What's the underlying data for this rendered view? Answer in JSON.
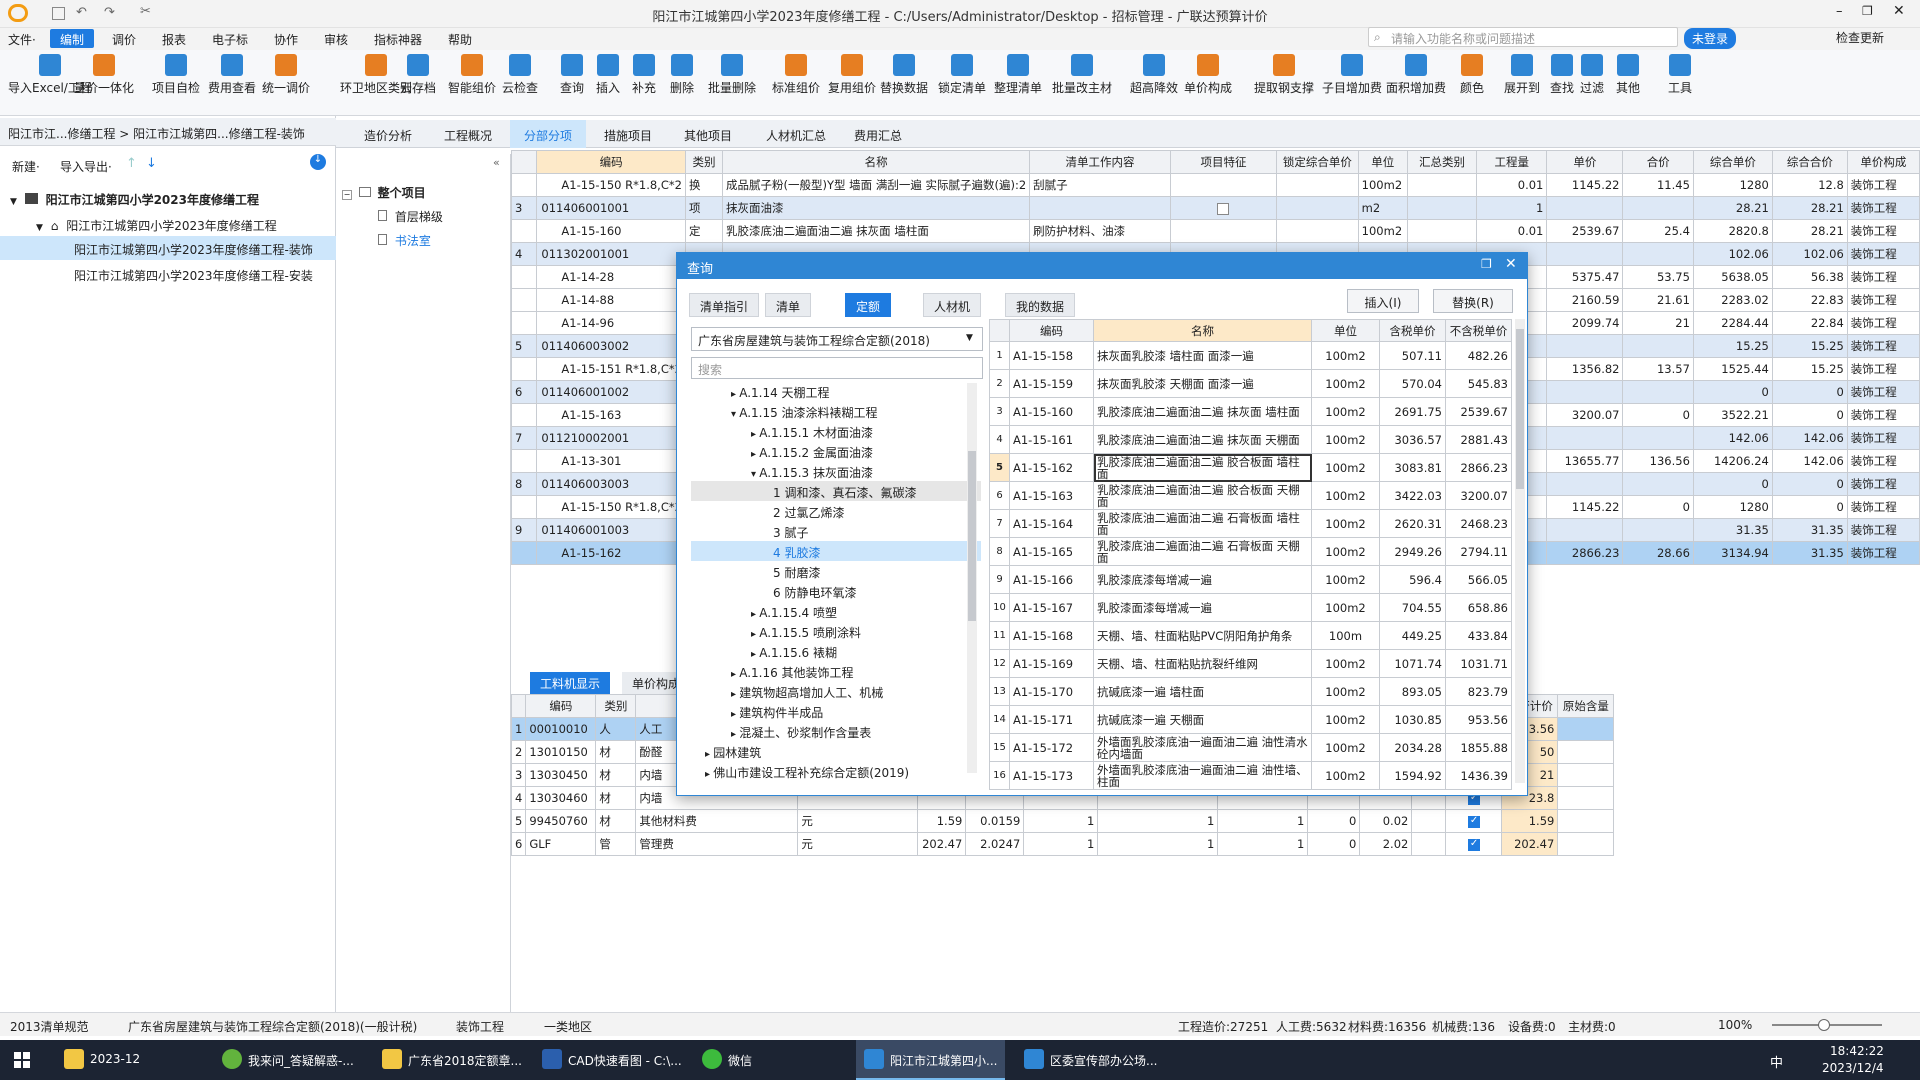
{
  "window": {
    "title": "阳江市江城第四小学2023年度修缮工程 - C:/Users/Administrator/Desktop - 招标管理 - 广联达预算计价"
  },
  "menu": [
    "文件·",
    "编制",
    "调价",
    "报表",
    "电子标",
    "协作",
    "审核",
    "指标神器",
    "帮助"
  ],
  "search": {
    "placeholder": "请输入功能名称或问题描述"
  },
  "account": {
    "login": "未登录",
    "check_update": "检查更新"
  },
  "ribbon": [
    {
      "label": "导入Excel/工程"
    },
    {
      "label": "量价一体化"
    },
    {
      "label": "项目自检"
    },
    {
      "label": "费用查看"
    },
    {
      "label": "统一调价"
    },
    {
      "label": "环卫地区类别"
    },
    {
      "label": "云存档"
    },
    {
      "label": "智能组价"
    },
    {
      "label": "云检查"
    },
    {
      "label": "查询"
    },
    {
      "label": "插入"
    },
    {
      "label": "补充"
    },
    {
      "label": "删除"
    },
    {
      "label": "批量删除"
    },
    {
      "label": "标准组价"
    },
    {
      "label": "复用组价"
    },
    {
      "label": "替换数据"
    },
    {
      "label": "锁定清单"
    },
    {
      "label": "整理清单"
    },
    {
      "label": "批量改主材"
    },
    {
      "label": "超高降效"
    },
    {
      "label": "单价构成"
    },
    {
      "label": "提取钢支撑"
    },
    {
      "label": "子目增加费"
    },
    {
      "label": "面积增加费"
    },
    {
      "label": "颜色"
    },
    {
      "label": "展开到"
    },
    {
      "label": "查找"
    },
    {
      "label": "过滤"
    },
    {
      "label": "其他"
    },
    {
      "label": "工具"
    }
  ],
  "left": {
    "breadcrumb": "阳江市江...修缮工程 > 阳江市江城第四...修缮工程-装饰",
    "new_label": "新建·",
    "import_label": "导入导出·",
    "tree": [
      "阳江市江城第四小学2023年度修缮工程",
      "阳江市江城第四小学2023年度修缮工程",
      "阳江市江城第四小学2023年度修缮工程-装饰",
      "阳江市江城第四小学2023年度修缮工程-安装"
    ]
  },
  "subtree": [
    "整个项目",
    "首层梯级",
    "书法室"
  ],
  "tabs": [
    "造价分析",
    "工程概况",
    "分部分项",
    "措施项目",
    "其他项目",
    "人材机汇总",
    "费用汇总"
  ],
  "main_table": {
    "headers": [
      "编码",
      "类别",
      "名称",
      "清单工作内容",
      "项目特征",
      "锁定综合单价",
      "单位",
      "汇总类别",
      "工程量",
      "单价",
      "合价",
      "综合单价",
      "综合合价",
      "单价构成"
    ],
    "rows": [
      {
        "no": "",
        "code": "A1-15-150 R*1.8,C*2",
        "type": "换",
        "name": "成品腻子粉(一般型)Y型 墙面 满刮一遍 实际腻子遍数(遍):2",
        "work": "刮腻子",
        "unit": "100m2",
        "qty": "0.01",
        "price": "1145.22",
        "total": "11.45",
        "uprice": "1280",
        "utotal": "12.8",
        "comp": "装饰工程"
      },
      {
        "no": "3",
        "code": "011406001001",
        "type": "项",
        "name": "抹灰面油漆",
        "work": "",
        "unit": "m2",
        "qty": "1",
        "price": "",
        "total": "",
        "uprice": "28.21",
        "utotal": "28.21",
        "comp": "装饰工程"
      },
      {
        "no": "",
        "code": "A1-15-160",
        "type": "定",
        "name": "乳胶漆底油二遍面油二遍 抹灰面 墙柱面",
        "work": "刷防护材料、油漆",
        "unit": "100m2",
        "qty": "0.01",
        "price": "2539.67",
        "total": "25.4",
        "uprice": "2820.8",
        "utotal": "28.21",
        "comp": "装饰工程"
      },
      {
        "no": "4",
        "code": "011302001001",
        "type": "",
        "name": "",
        "work": "",
        "unit": "",
        "qty": "",
        "price": "",
        "total": "",
        "uprice": "102.06",
        "utotal": "102.06",
        "comp": "装饰工程"
      },
      {
        "no": "",
        "code": "A1-14-28",
        "type": "",
        "name": "",
        "work": "",
        "unit": "",
        "qty": "",
        "price": "5375.47",
        "total": "53.75",
        "uprice": "5638.05",
        "utotal": "56.38",
        "comp": "装饰工程"
      },
      {
        "no": "",
        "code": "A1-14-88",
        "type": "",
        "name": "",
        "work": "",
        "unit": "",
        "qty": "",
        "price": "2160.59",
        "total": "21.61",
        "uprice": "2283.02",
        "utotal": "22.83",
        "comp": "装饰工程"
      },
      {
        "no": "",
        "code": "A1-14-96",
        "type": "",
        "name": "",
        "work": "",
        "unit": "",
        "qty": "",
        "price": "2099.74",
        "total": "21",
        "uprice": "2284.44",
        "utotal": "22.84",
        "comp": "装饰工程"
      },
      {
        "no": "5",
        "code": "011406003002",
        "type": "",
        "name": "",
        "work": "",
        "unit": "",
        "qty": "",
        "price": "",
        "total": "",
        "uprice": "15.25",
        "utotal": "15.25",
        "comp": "装饰工程"
      },
      {
        "no": "",
        "code": "A1-15-151 R*1.8,C*2",
        "type": "",
        "name": "",
        "work": "",
        "unit": "",
        "qty": "",
        "price": "1356.82",
        "total": "13.57",
        "uprice": "1525.44",
        "utotal": "15.25",
        "comp": "装饰工程"
      },
      {
        "no": "6",
        "code": "011406001002",
        "type": "",
        "name": "",
        "work": "",
        "unit": "",
        "qty": "",
        "price": "",
        "total": "",
        "uprice": "0",
        "utotal": "0",
        "comp": "装饰工程"
      },
      {
        "no": "",
        "code": "A1-15-163",
        "type": "",
        "name": "",
        "work": "",
        "unit": "",
        "qty": "",
        "price": "3200.07",
        "total": "0",
        "uprice": "3522.21",
        "utotal": "0",
        "comp": "装饰工程"
      },
      {
        "no": "7",
        "code": "011210002001",
        "type": "",
        "name": "",
        "work": "",
        "unit": "",
        "qty": "",
        "price": "",
        "total": "",
        "uprice": "142.06",
        "utotal": "142.06",
        "comp": "装饰工程"
      },
      {
        "no": "",
        "code": "A1-13-301",
        "type": "",
        "name": "",
        "work": "",
        "unit": "",
        "qty": "",
        "price": "13655.77",
        "total": "136.56",
        "uprice": "14206.24",
        "utotal": "142.06",
        "comp": "装饰工程"
      },
      {
        "no": "8",
        "code": "011406003003",
        "type": "",
        "name": "",
        "work": "",
        "unit": "",
        "qty": "",
        "price": "",
        "total": "",
        "uprice": "0",
        "utotal": "0",
        "comp": "装饰工程"
      },
      {
        "no": "",
        "code": "A1-15-150 R*1.8,C*2",
        "type": "",
        "name": "",
        "work": "",
        "unit": "",
        "qty": "",
        "price": "1145.22",
        "total": "0",
        "uprice": "1280",
        "utotal": "0",
        "comp": "装饰工程"
      },
      {
        "no": "9",
        "code": "011406001003",
        "type": "",
        "name": "",
        "work": "",
        "unit": "",
        "qty": "",
        "price": "",
        "total": "",
        "uprice": "31.35",
        "utotal": "31.35",
        "comp": "装饰工程"
      },
      {
        "no": "",
        "code": "A1-15-162",
        "type": "",
        "name": "",
        "work": "",
        "unit": "",
        "qty": "",
        "price": "2866.23",
        "total": "28.66",
        "uprice": "3134.94",
        "utotal": "31.35",
        "comp": "装饰工程"
      }
    ]
  },
  "lower_tabs": [
    "工料机显示",
    "单价构成"
  ],
  "bottom_table": {
    "headers": [
      "编码",
      "类别",
      "名称",
      "",
      "",
      "",
      "",
      "",
      "",
      "",
      "",
      "",
      "量",
      "是否计价",
      "原始含量"
    ],
    "rows": [
      {
        "no": "1",
        "code": "00010010",
        "type": "人",
        "name": "人工",
        "unit": "",
        "a": "",
        "b": "",
        "c": "",
        "d": "",
        "e": "",
        "f": "",
        "g": "",
        "orig": "1343.56"
      },
      {
        "no": "2",
        "code": "13010150",
        "type": "材",
        "name": "酚醛",
        "unit": "",
        "a": "",
        "b": "",
        "c": "",
        "d": "",
        "e": "",
        "f": "",
        "g": "",
        "orig": "50"
      },
      {
        "no": "3",
        "code": "13030450",
        "type": "材",
        "name": "内墙",
        "unit": "",
        "a": "",
        "b": "",
        "c": "",
        "d": "",
        "e": "",
        "f": "",
        "g": "",
        "orig": "21"
      },
      {
        "no": "4",
        "code": "13030460",
        "type": "材",
        "name": "内墙",
        "unit": "",
        "a": "",
        "b": "",
        "c": "",
        "d": "",
        "e": "",
        "f": "",
        "g": "",
        "orig": "23.8"
      },
      {
        "no": "5",
        "code": "99450760",
        "type": "材",
        "name": "其他材料费",
        "unit": "元",
        "a": "1.59",
        "b": "0.0159",
        "c": "1",
        "d": "1",
        "e": "1",
        "f": "0",
        "g": "0.02",
        "orig": "1.59"
      },
      {
        "no": "6",
        "code": "GLF",
        "type": "管",
        "name": "管理费",
        "unit": "元",
        "a": "202.47",
        "b": "2.0247",
        "c": "1",
        "d": "1",
        "e": "1",
        "f": "0",
        "g": "2.02",
        "orig": "202.47"
      }
    ]
  },
  "dialog": {
    "title": "查询",
    "tabs": [
      "清单指引",
      "清单",
      "定额",
      "人材机",
      "我的数据"
    ],
    "insert": "插入(I)",
    "replace": "替换(R)",
    "quota_select": "广东省房屋建筑与装饰工程综合定额(2018)",
    "search_placeholder": "搜索",
    "tree": [
      "A.1.14 天棚工程",
      "A.1.15 油漆涂料裱糊工程",
      "A.1.15.1 木材面油漆",
      "A.1.15.2 金属面油漆",
      "A.1.15.3 抹灰面油漆",
      "1 调和漆、真石漆、氟碳漆",
      "2 过氯乙烯漆",
      "3 腻子",
      "4 乳胶漆",
      "5 耐磨漆",
      "6 防静电环氧漆",
      "A.1.15.4 喷塑",
      "A.1.15.5 喷刷涂料",
      "A.1.15.6 裱糊",
      "A.1.16 其他装饰工程",
      "建筑物超高增加人工、机械",
      "建筑构件半成品",
      "混凝土、砂浆制作含量表",
      "园林建筑",
      "佛山市建设工程补充综合定额(2019)"
    ],
    "headers": [
      "编码",
      "名称",
      "单位",
      "含税单价",
      "不含税单价"
    ],
    "rows": [
      {
        "no": "1",
        "code": "A1-15-158",
        "name": "抹灰面乳胶漆 墙柱面 面漆一遍",
        "unit": "100m2",
        "tax": "507.11",
        "notax": "482.26"
      },
      {
        "no": "2",
        "code": "A1-15-159",
        "name": "抹灰面乳胶漆 天棚面 面漆一遍",
        "unit": "100m2",
        "tax": "570.04",
        "notax": "545.83"
      },
      {
        "no": "3",
        "code": "A1-15-160",
        "name": "乳胶漆底油二遍面油二遍 抹灰面 墙柱面",
        "unit": "100m2",
        "tax": "2691.75",
        "notax": "2539.67"
      },
      {
        "no": "4",
        "code": "A1-15-161",
        "name": "乳胶漆底油二遍面油二遍 抹灰面 天棚面",
        "unit": "100m2",
        "tax": "3036.57",
        "notax": "2881.43"
      },
      {
        "no": "5",
        "code": "A1-15-162",
        "name": "乳胶漆底油二遍面油二遍 胶合板面 墙柱面",
        "unit": "100m2",
        "tax": "3083.81",
        "notax": "2866.23"
      },
      {
        "no": "6",
        "code": "A1-15-163",
        "name": "乳胶漆底油二遍面油二遍 胶合板面 天棚面",
        "unit": "100m2",
        "tax": "3422.03",
        "notax": "3200.07"
      },
      {
        "no": "7",
        "code": "A1-15-164",
        "name": "乳胶漆底油二遍面油二遍 石膏板面 墙柱面",
        "unit": "100m2",
        "tax": "2620.31",
        "notax": "2468.23"
      },
      {
        "no": "8",
        "code": "A1-15-165",
        "name": "乳胶漆底油二遍面油二遍 石膏板面 天棚面",
        "unit": "100m2",
        "tax": "2949.26",
        "notax": "2794.11"
      },
      {
        "no": "9",
        "code": "A1-15-166",
        "name": "乳胶漆底漆每增减一遍",
        "unit": "100m2",
        "tax": "596.4",
        "notax": "566.05"
      },
      {
        "no": "10",
        "code": "A1-15-167",
        "name": "乳胶漆面漆每增减一遍",
        "unit": "100m2",
        "tax": "704.55",
        "notax": "658.86"
      },
      {
        "no": "11",
        "code": "A1-15-168",
        "name": "天棚、墙、柱面粘贴PVC阴阳角护角条",
        "unit": "100m",
        "tax": "449.25",
        "notax": "433.84"
      },
      {
        "no": "12",
        "code": "A1-15-169",
        "name": "天棚、墙、柱面粘贴抗裂纤维网",
        "unit": "100m2",
        "tax": "1071.74",
        "notax": "1031.71"
      },
      {
        "no": "13",
        "code": "A1-15-170",
        "name": "抗碱底漆一遍 墙柱面",
        "unit": "100m2",
        "tax": "893.05",
        "notax": "823.79"
      },
      {
        "no": "14",
        "code": "A1-15-171",
        "name": "抗碱底漆一遍 天棚面",
        "unit": "100m2",
        "tax": "1030.85",
        "notax": "953.56"
      },
      {
        "no": "15",
        "code": "A1-15-172",
        "name": "外墙面乳胶漆底油一遍面油二遍 油性清水砼内墙面",
        "unit": "100m2",
        "tax": "2034.28",
        "notax": "1855.88"
      },
      {
        "no": "16",
        "code": "A1-15-173",
        "name": "外墙面乳胶漆底油一遍面油二遍 油性墙、柱面",
        "unit": "100m2",
        "tax": "1594.92",
        "notax": "1436.39"
      }
    ]
  },
  "edit_cell": "A1-15-162",
  "status": [
    "2013清单规范",
    "广东省房屋建筑与装饰工程综合定额(2018)(一般计税)",
    "装饰工程",
    "一类地区",
    "工程造价:27251",
    "人工费:5632",
    "材料费:16356",
    "机械费:136",
    "设备费:0",
    "主材费:0",
    "100%"
  ],
  "taskbar": [
    {
      "label": "2023-12"
    },
    {
      "label": "我来问_答疑解惑-..."
    },
    {
      "label": "广东省2018定额章..."
    },
    {
      "label": "CAD快速看图 - C:\\..."
    },
    {
      "label": "微信"
    },
    {
      "label": "阳江市江城第四小..."
    },
    {
      "label": "区委宣传部办公场..."
    }
  ],
  "clock": {
    "time": "18:42:22",
    "date": "2023/12/4",
    "ime": "中"
  }
}
